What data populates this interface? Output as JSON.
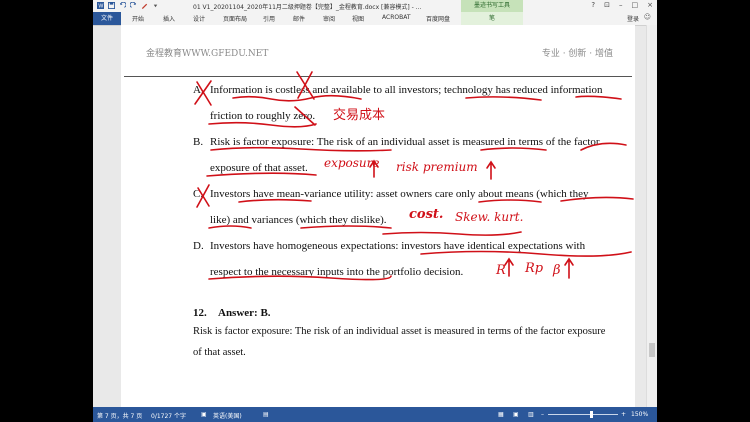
{
  "window": {
    "title": "01 V1_20201104_2020年11月二级押题卷【完整】_金程教育.docx [兼容模式] - ...",
    "context_group": "墨迹书写工具",
    "controls": [
      "?",
      "⊡",
      "–",
      "□",
      "×"
    ]
  },
  "ribbon": {
    "tabs": [
      "文件",
      "开始",
      "插入",
      "设计",
      "页面布局",
      "引用",
      "邮件",
      "审阅",
      "视图",
      "ACROBAT",
      "百度网盘",
      "笔"
    ],
    "login": "登录"
  },
  "page": {
    "header_left": "金程教育WWW.GFEDU.NET",
    "header_right": "专业 · 创新 · 增值",
    "options": [
      {
        "label": "A.",
        "lines": [
          "Information is costless and available to all investors; technology has reduced information",
          "friction to roughly zero."
        ]
      },
      {
        "label": "B.",
        "lines": [
          "Risk is factor exposure: The risk of an individual asset is measured in terms of the factor",
          "exposure of that asset."
        ]
      },
      {
        "label": "C.",
        "lines": [
          "Investors have mean-variance utility: asset owners care only about means (which they",
          "like) and variances (which they dislike)."
        ]
      },
      {
        "label": "D.",
        "lines": [
          "Investors have homogeneous expectations: investors have identical expectations with",
          "respect to the necessary inputs into the portfolio decision."
        ]
      }
    ],
    "answer_number": "12.",
    "answer_label": "Answer: B.",
    "explanation_lines": [
      "Risk is factor exposure: The risk of an individual asset is measured in terms of the factor exposure",
      "of that asset."
    ]
  },
  "handwriting": {
    "note_a": "交易成本",
    "note_b1": "exposure",
    "note_b2": "risk premium",
    "note_c1": "cost.",
    "note_c2": "Skew. kurt.",
    "note_d1": "R",
    "note_d2": "Rp",
    "note_d3": "β"
  },
  "statusbar": {
    "page": "第 7 页，共 7 页",
    "words": "0/1727 个字",
    "language": "英语(美国)",
    "zoom": "150%"
  },
  "colors": {
    "accent": "#2b579a",
    "ink": "#d01018",
    "context": "#c6e2b9"
  }
}
